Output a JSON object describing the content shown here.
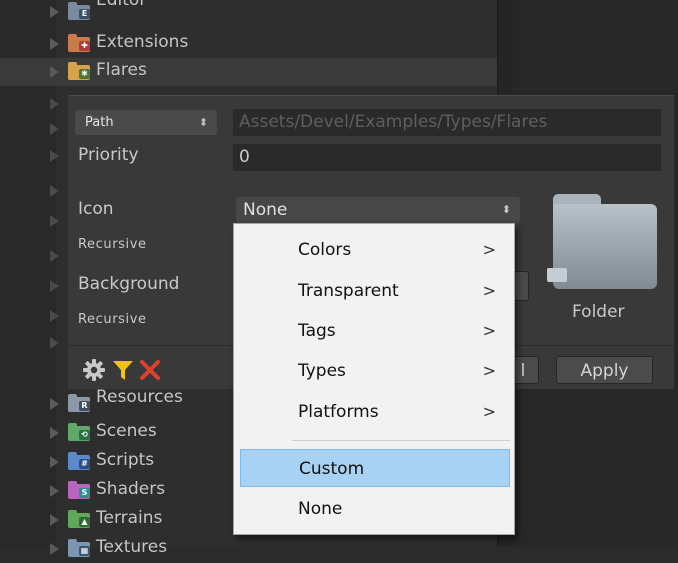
{
  "tree": {
    "items": [
      {
        "label": "Editor",
        "color": "#7a8aa0",
        "badge": "E",
        "badge_color": "#3d4f66"
      },
      {
        "label": "Extensions",
        "color": "#c97c4a",
        "badge": "✚",
        "badge_color": "#b33a3a"
      },
      {
        "label": "Flares",
        "color": "#d6a24a",
        "badge": "✱",
        "badge_color": "#4a7a32"
      },
      {
        "label": "Resources",
        "color": "#8a98a8",
        "badge": "R",
        "badge_color": "#40505e"
      },
      {
        "label": "Scenes",
        "color": "#5fa86a",
        "badge": "⟲",
        "badge_color": "#2f7040"
      },
      {
        "label": "Scripts",
        "color": "#5a8ac8",
        "badge": "#",
        "badge_color": "#2a4f86"
      },
      {
        "label": "Shaders",
        "color": "#b865c0",
        "badge": "S",
        "badge_color": "#2f8f8f"
      },
      {
        "label": "Terrains",
        "color": "#62a85a",
        "badge": "▲",
        "badge_color": "#2e6a35"
      },
      {
        "label": "Textures",
        "color": "#7a96b0",
        "badge": "▦",
        "badge_color": "#3a5570"
      }
    ]
  },
  "inspector": {
    "path_mode": "Path",
    "path_value": "Assets/Devel/Examples/Types/Flares",
    "priority_label": "Priority",
    "priority_value": "0",
    "icon_label": "Icon",
    "icon_value": "None",
    "recursive_label_1": "Recursive",
    "background_label": "Background",
    "recursive_label_2": "Recursive",
    "folder_label": "Folder",
    "apply_label": "Apply",
    "revert_label_fragment": "l"
  },
  "menu": {
    "items": [
      {
        "label": "Colors",
        "submenu": true
      },
      {
        "label": "Transparent",
        "submenu": true
      },
      {
        "label": "Tags",
        "submenu": true
      },
      {
        "label": "Types",
        "submenu": true
      },
      {
        "label": "Platforms",
        "submenu": true
      },
      {
        "label": "Custom",
        "submenu": false
      },
      {
        "label": "None",
        "submenu": false
      }
    ],
    "highlighted": "Custom"
  },
  "toolbar": {
    "icons": [
      "gear-icon",
      "filter-icon",
      "close-icon"
    ]
  }
}
